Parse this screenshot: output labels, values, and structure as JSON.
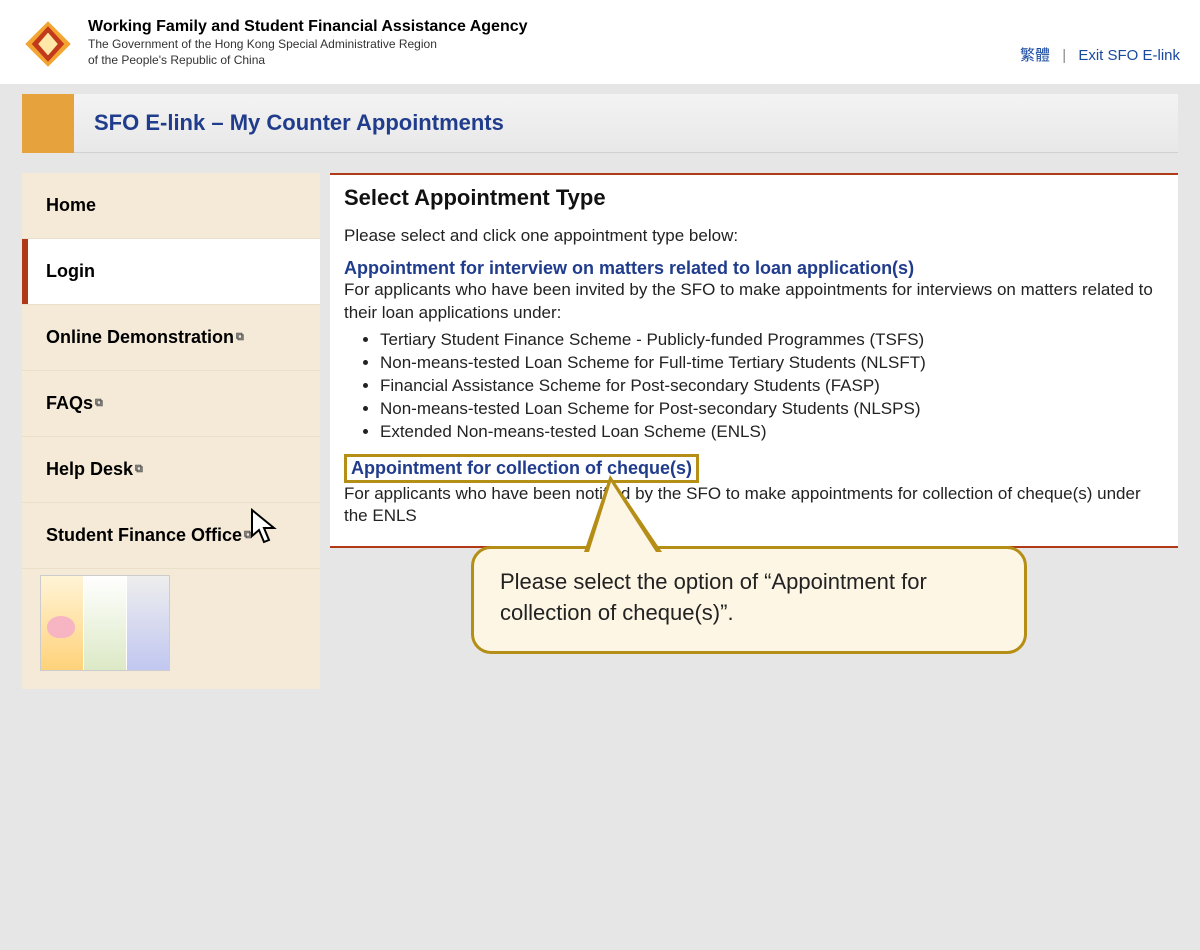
{
  "header": {
    "org_title": "Working Family and Student Financial Assistance Agency",
    "org_sub1": "The Government of the Hong Kong Special Administrative Region",
    "org_sub2": "of the People's Republic of China",
    "lang_link": "繁體",
    "exit_link": "Exit SFO E-link"
  },
  "page_title": "SFO E-link – My Counter Appointments",
  "sidebar": {
    "items": [
      {
        "label": "Home"
      },
      {
        "label": "Login"
      },
      {
        "label": "Online Demonstration",
        "external": true
      },
      {
        "label": "FAQs",
        "external": true
      },
      {
        "label": "Help Desk",
        "external": true
      },
      {
        "label": "Student Finance Office",
        "external": true
      }
    ]
  },
  "main": {
    "heading": "Select Appointment Type",
    "intro": "Please select and click one appointment type below:",
    "appt1_title": "Appointment for interview on matters related to loan application(s)",
    "appt1_desc": "For applicants who have been invited by the SFO to make appointments for interviews on matters related to their loan applications under:",
    "appt1_bullets": [
      "Tertiary Student Finance Scheme - Publicly-funded Programmes (TSFS)",
      "Non-means-tested Loan Scheme for Full-time Tertiary Students (NLSFT)",
      "Financial Assistance Scheme for Post-secondary Students (FASP)",
      "Non-means-tested Loan Scheme for Post-secondary Students (NLSPS)",
      "Extended Non-means-tested Loan Scheme (ENLS)"
    ],
    "appt2_title": "Appointment for collection of cheque(s)",
    "appt2_desc": "For applicants who have been notified by the SFO to make appointments for collection of cheque(s) under the ENLS"
  },
  "callout": {
    "text": "Please select the option of “Appointment for collection of cheque(s)”."
  }
}
